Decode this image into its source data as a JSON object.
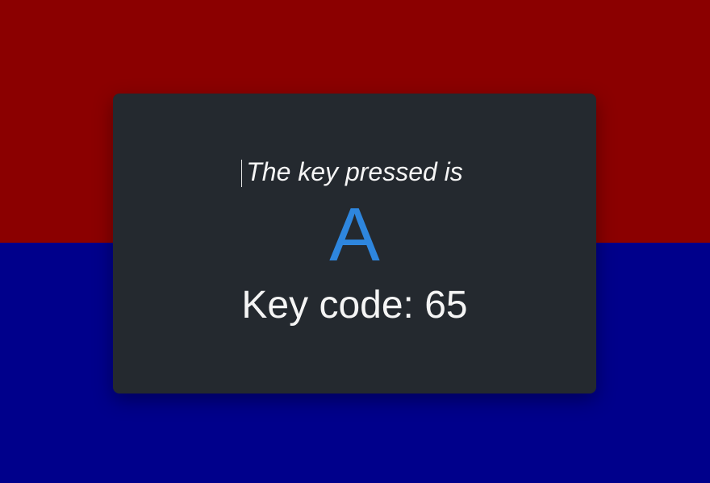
{
  "intro_text": "The key pressed is",
  "key": "A",
  "key_code_text": "Key code: 65",
  "colors": {
    "background_top": "#8b0000",
    "background_bottom": "#00008b",
    "card": "#24292f",
    "key_accent": "#2e86de",
    "text": "#f5f5f5"
  }
}
